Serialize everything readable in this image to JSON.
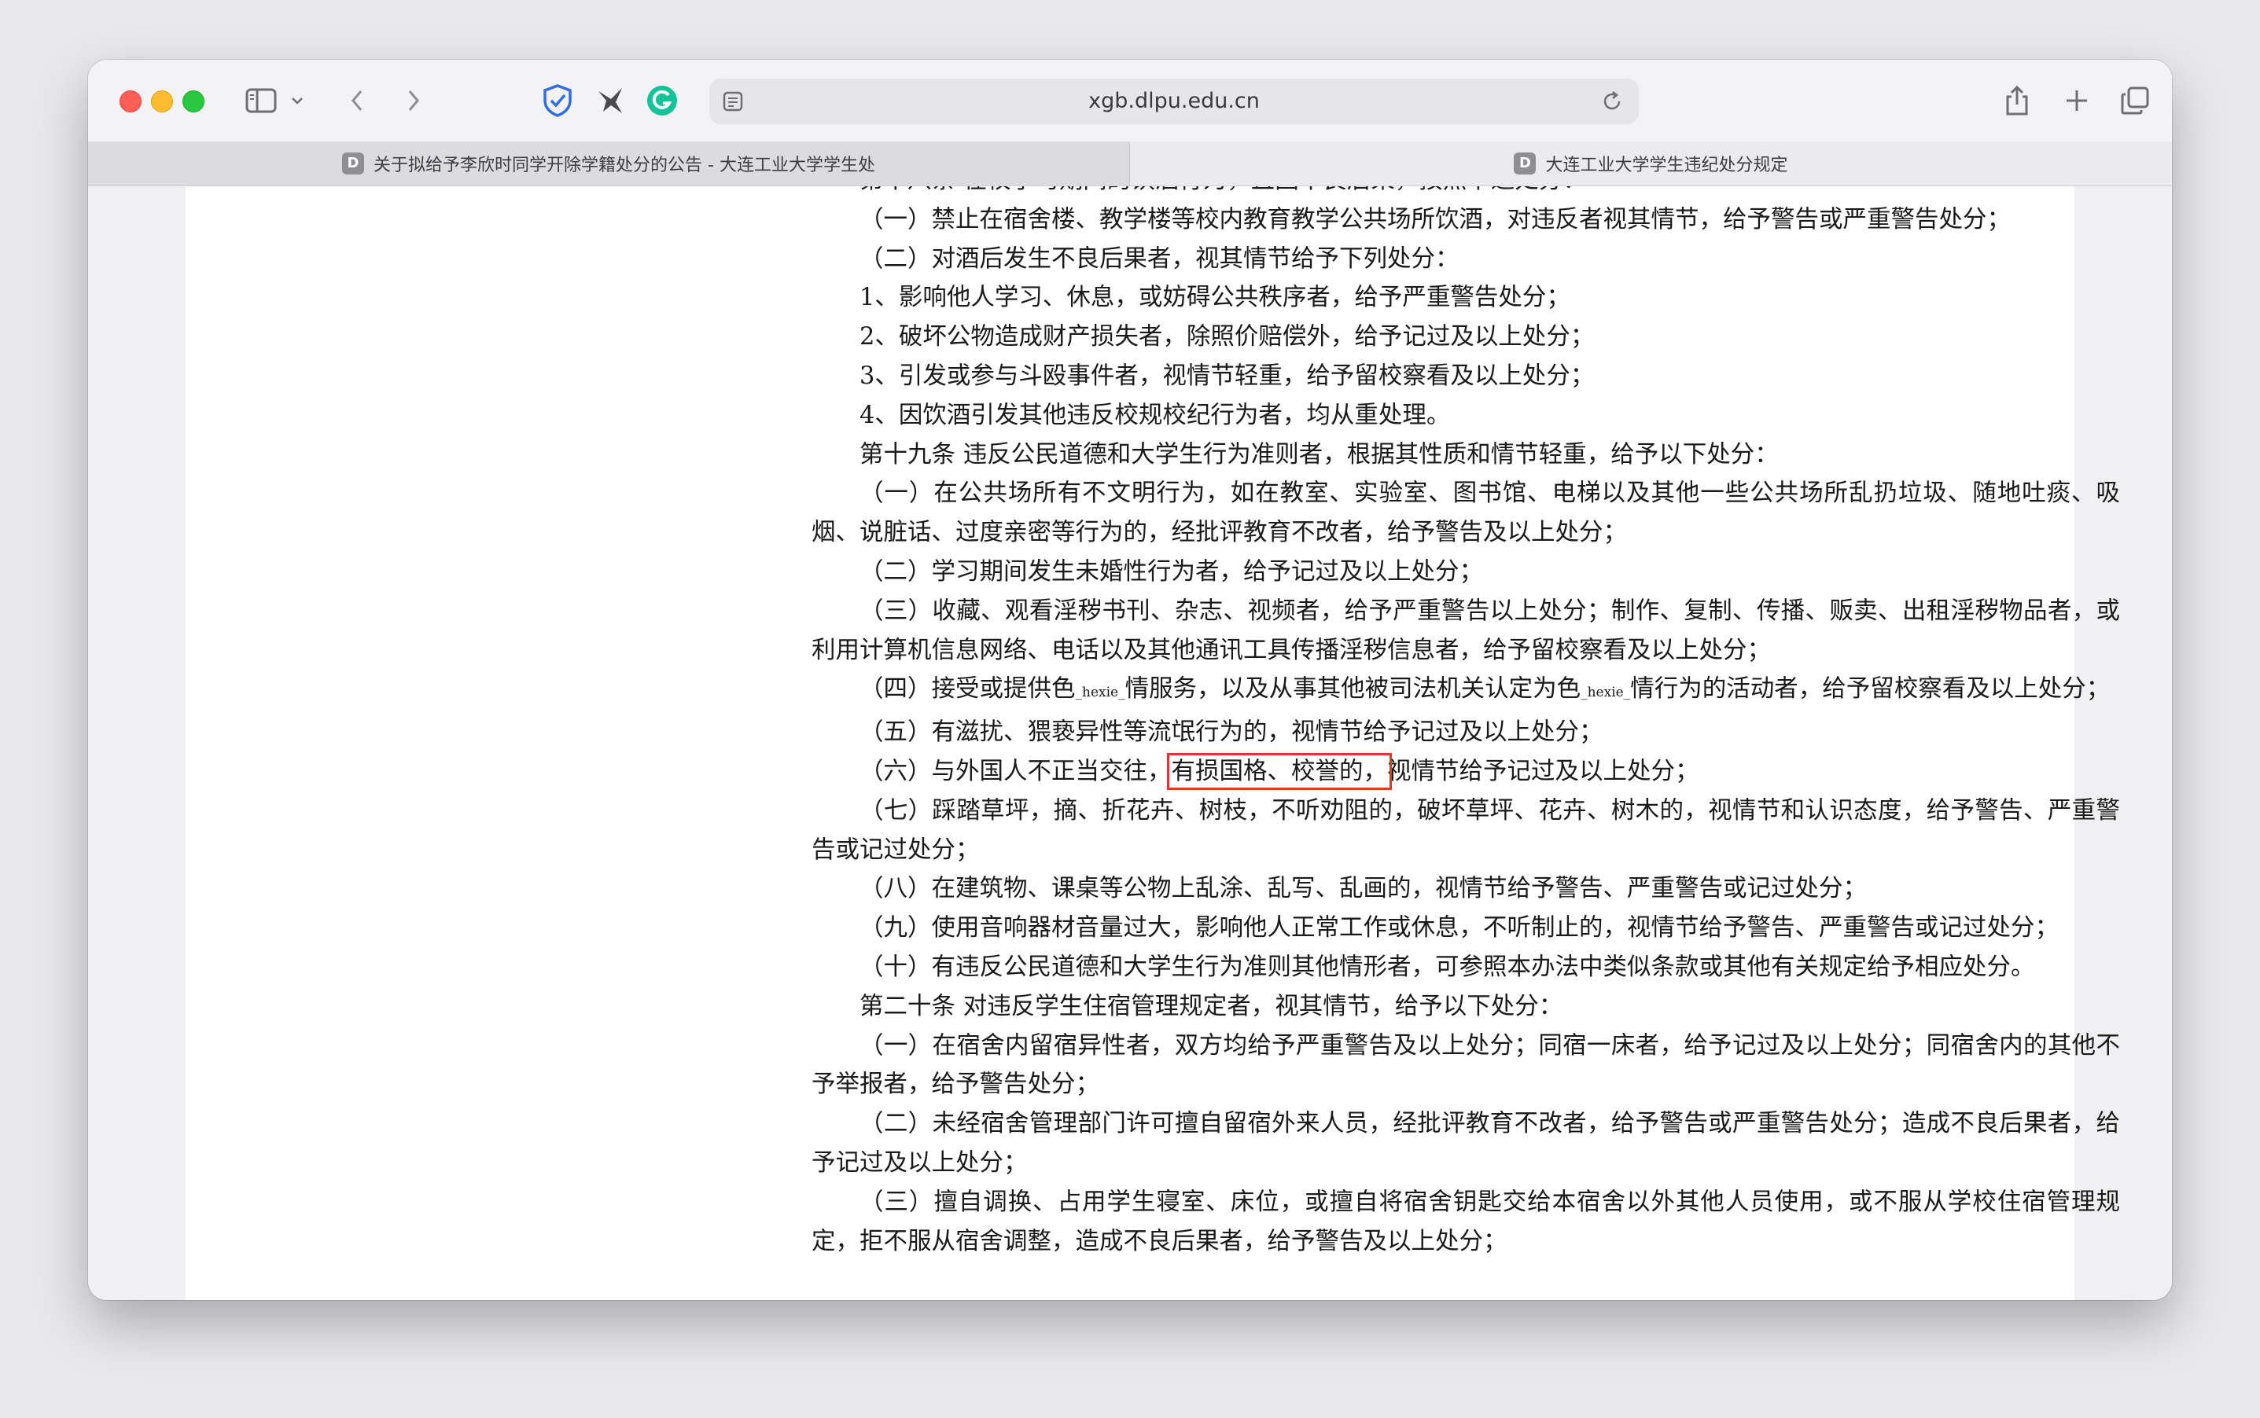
{
  "browser": {
    "url": "xgb.dlpu.edu.cn",
    "tabs": [
      {
        "favicon": "D",
        "title": "关于拟给予李欣时同学开除学籍处分的公告 - 大连工业大学学生处"
      },
      {
        "favicon": "D",
        "title": "大连工业大学学生违纪处分规定"
      }
    ]
  },
  "document": {
    "lines": [
      "第十八条 在校学习期间的饮酒行为，且因不良后果，按照下述处分：",
      "（一）禁止在宿舍楼、教学楼等校内教育教学公共场所饮酒，对违反者视其情节，给予警告或严重警告处分；",
      "（二）对酒后发生不良后果者，视其情节给予下列处分：",
      "1、影响他人学习、休息，或妨碍公共秩序者，给予严重警告处分；",
      "2、破坏公物造成财产损失者，除照价赔偿外，给予记过及以上处分；",
      "3、引发或参与斗殴事件者，视情节轻重，给予留校察看及以上处分；",
      "4、因饮酒引发其他违反校规校纪行为者，均从重处理。",
      "第十九条 违反公民道德和大学生行为准则者，根据其性质和情节轻重，给予以下处分：",
      "（一）在公共场所有不文明行为，如在教室、实验室、图书馆、电梯以及其他一些公共场所乱扔垃圾、随地吐痰、吸烟、说脏话、过度亲密等行为的，经批评教育不改者，给予警告及以上处分；",
      "（二）学习期间发生未婚性行为者，给予记过及以上处分；",
      "（三）收藏、观看淫秽书刊、杂志、视频者，给予严重警告以上处分；制作、复制、传播、贩卖、出租淫秽物品者，或利用计算机信息网络、电话以及其他通讯工具传播淫秽信息者，给予留校察看及以上处分；"
    ],
    "line_12_parts": [
      "（四）接受或提供色",
      "_hexie_",
      "情服务，以及从事其他被司法机关认定为色",
      "_hexie_",
      "情行为的活动者，给予留校察看及以上处分；"
    ],
    "line_13": "（五）有滋扰、猥亵异性等流氓行为的，视情节给予记过及以上处分；",
    "line_14_parts": [
      "（六）与外国人不正当交往，",
      "有损国格、校誉的，",
      "视情节给予记过及以上处分；"
    ],
    "lines_after": [
      "（七）踩踏草坪，摘、折花卉、树枝，不听劝阻的，破坏草坪、花卉、树木的，视情节和认识态度，给予警告、严重警告或记过处分；",
      "（八）在建筑物、课桌等公物上乱涂、乱写、乱画的，视情节给予警告、严重警告或记过处分；",
      "（九）使用音响器材音量过大，影响他人正常工作或休息，不听制止的，视情节给予警告、严重警告或记过处分；",
      "（十）有违反公民道德和大学生行为准则其他情形者，可参照本办法中类似条款或其他有关规定给予相应处分。",
      "第二十条 对违反学生住宿管理规定者，视其情节，给予以下处分：",
      "（一）在宿舍内留宿异性者，双方均给予严重警告及以上处分；同宿一床者，给予记过及以上处分；同宿舍内的其他不予举报者，给予警告处分；",
      "（二）未经宿舍管理部门许可擅自留宿外来人员，经批评教育不改者，给予警告或严重警告处分；造成不良后果者，给予记过及以上处分；",
      "（三）擅自调换、占用学生寝室、床位，或擅自将宿舍钥匙交给本宿舍以外其他人员使用，或不服从学校住宿管理规定，拒不服从宿舍调整，造成不良后果者，给予警告及以上处分；"
    ]
  },
  "colors": {
    "highlight_box": "#e0372b"
  }
}
